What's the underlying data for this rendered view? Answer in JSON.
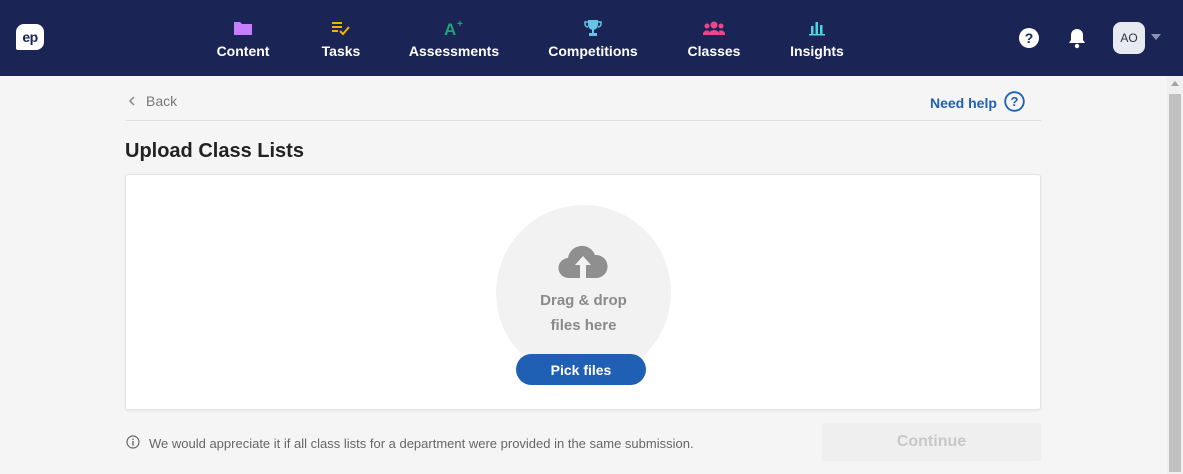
{
  "nav": {
    "logo": "ep",
    "items": [
      {
        "label": "Content",
        "icon": "folder-icon",
        "color": "#c77dff"
      },
      {
        "label": "Tasks",
        "icon": "checklist-icon",
        "color": "#f5b000"
      },
      {
        "label": "Assessments",
        "icon": "a-plus-icon",
        "color": "#1fa37a"
      },
      {
        "label": "Competitions",
        "icon": "trophy-icon",
        "color": "#67c3e6"
      },
      {
        "label": "Classes",
        "icon": "people-icon",
        "color": "#f2448d"
      },
      {
        "label": "Insights",
        "icon": "bar-chart-icon",
        "color": "#4fd3e0"
      }
    ],
    "avatar": "AO"
  },
  "page": {
    "back_label": "Back",
    "help_label": "Need help",
    "title": "Upload Class Lists",
    "drop_line1": "Drag & drop",
    "drop_line2": "files here",
    "pick_label": "Pick files",
    "info_text": "We would appreciate it if all class lists for a department were provided in the same submission.",
    "continue_label": "Continue"
  },
  "colors": {
    "nav_bg": "#1a2556",
    "accent": "#1f5fb4"
  }
}
